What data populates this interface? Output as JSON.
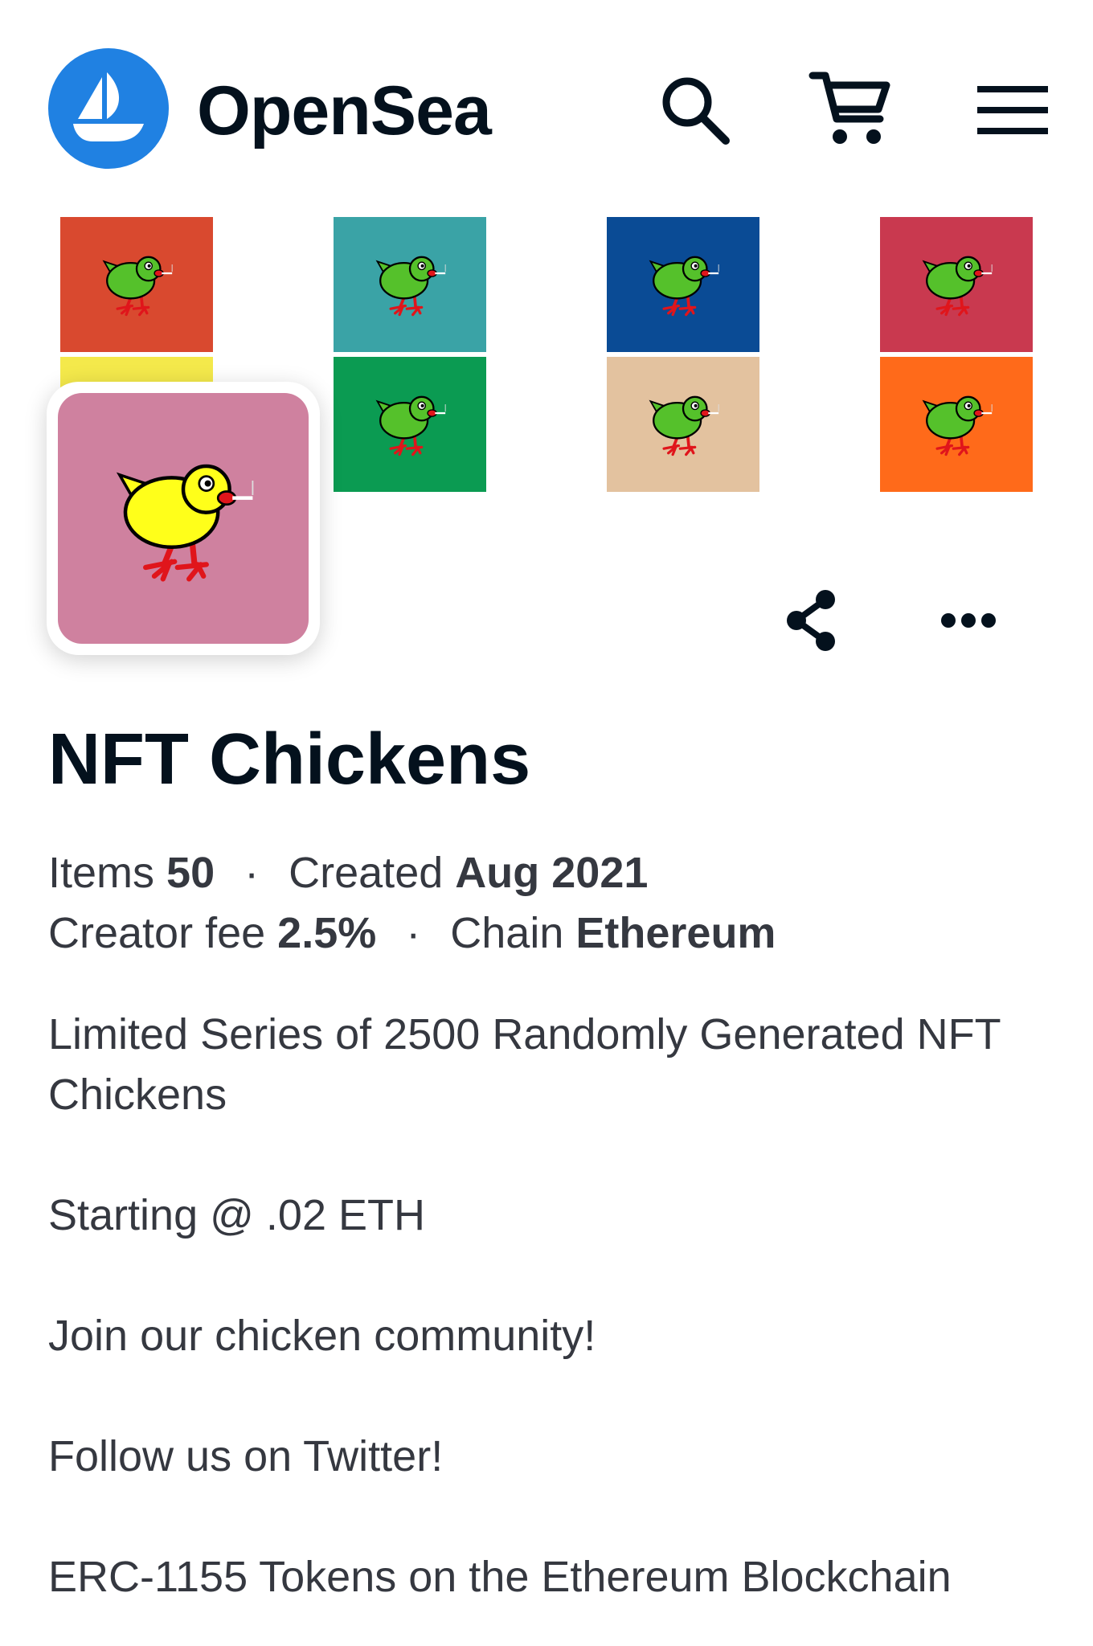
{
  "header": {
    "brand": "OpenSea",
    "icons": {
      "logo": "opensea-ship-icon",
      "search": "search-icon",
      "cart": "cart-icon",
      "menu": "hamburger-menu-icon"
    },
    "brand_color": "#2081e2"
  },
  "banner": {
    "tiles": [
      {
        "color": "#d9492f",
        "bird": "green"
      },
      {
        "color": "#3aa3a6",
        "bird": "green"
      },
      {
        "color": "#0a4b95",
        "bird": "green"
      },
      {
        "color": "#c9394f",
        "bird": "green"
      },
      {
        "color": "#f4e94b",
        "bird": "none"
      },
      {
        "color": "#0b9b52",
        "bird": "green"
      },
      {
        "color": "#e3c29f",
        "bird": "green"
      },
      {
        "color": "#ff6a1a",
        "bird": "green"
      }
    ]
  },
  "avatar": {
    "bg": "#cf819f",
    "bird": "yellow"
  },
  "actions": {
    "share_icon": "share-icon",
    "more_icon": "more-dots-icon"
  },
  "collection": {
    "title": "NFT Chickens",
    "items_label": "Items",
    "items_value": "50",
    "created_label": "Created",
    "created_value": "Aug 2021",
    "fee_label": "Creator fee",
    "fee_value": "2.5%",
    "chain_label": "Chain",
    "chain_value": "Ethereum",
    "separator": "·",
    "description": {
      "line1": "Limited Series of 2500 Randomly Generated NFT Chickens",
      "line2": "Starting @ .02 ETH",
      "line3": "Join our chicken community!",
      "line4": "Follow us on Twitter!",
      "line5": "ERC-1155 Tokens on the Ethereum Blockchain"
    }
  }
}
